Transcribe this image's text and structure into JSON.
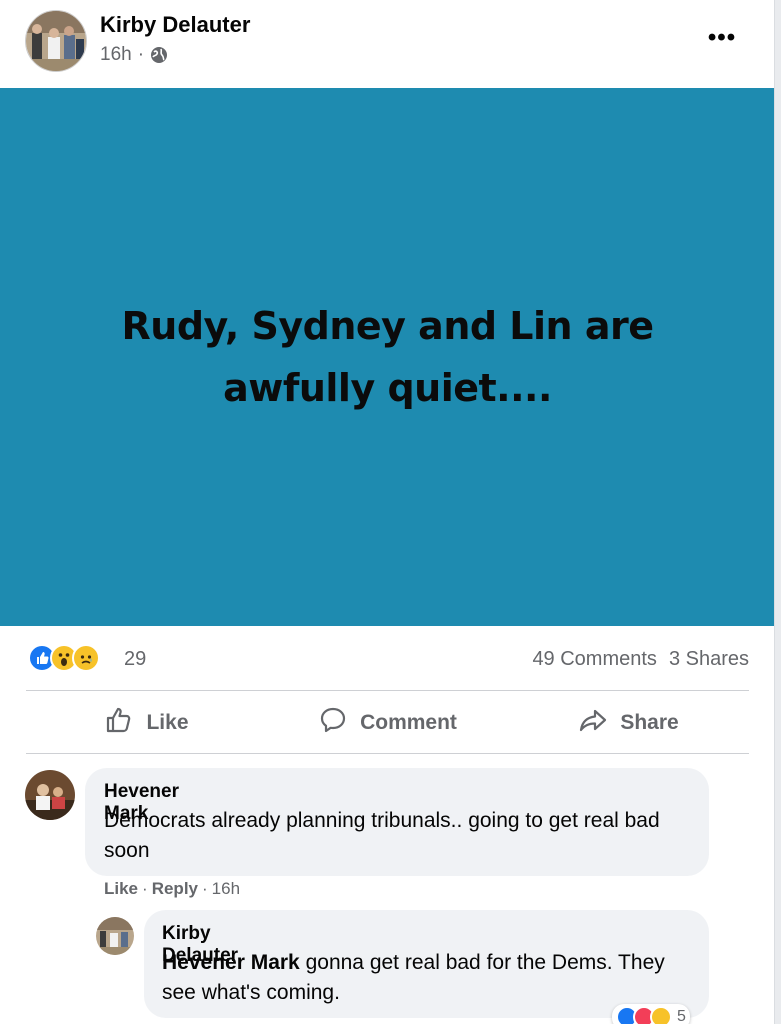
{
  "post": {
    "author": "Kirby Delauter",
    "time": "16h",
    "meta_sep": "·",
    "more_label": "•••",
    "image_text": "Rudy, Sydney and Lin are awfully quiet....",
    "image_bg": "#1e8bb0"
  },
  "stats": {
    "reaction_count": "29",
    "reaction_types": [
      "like-icon",
      "wow-icon",
      "sad-icon"
    ],
    "comments": "49 Comments",
    "shares": "3 Shares"
  },
  "actions": {
    "like": "Like",
    "comment": "Comment",
    "share": "Share"
  },
  "comments": [
    {
      "author": "Hevener Mark",
      "text": "Democrats already planning tribunals.. going to get real bad soon",
      "like": "Like",
      "reply": "Reply",
      "sep": "·",
      "time": "16h"
    },
    {
      "author": "Kirby Delauter",
      "mention": "Hevener Mark",
      "text": " gonna get real bad for the Dems. They see what's coming.",
      "reaction_count": "5",
      "reaction_types": [
        "like-icon",
        "love-icon",
        "care-icon"
      ]
    }
  ],
  "colors": {
    "like_blue": "#1877f2",
    "secondary_text": "#65676b",
    "bubble_bg": "#f0f2f5"
  }
}
